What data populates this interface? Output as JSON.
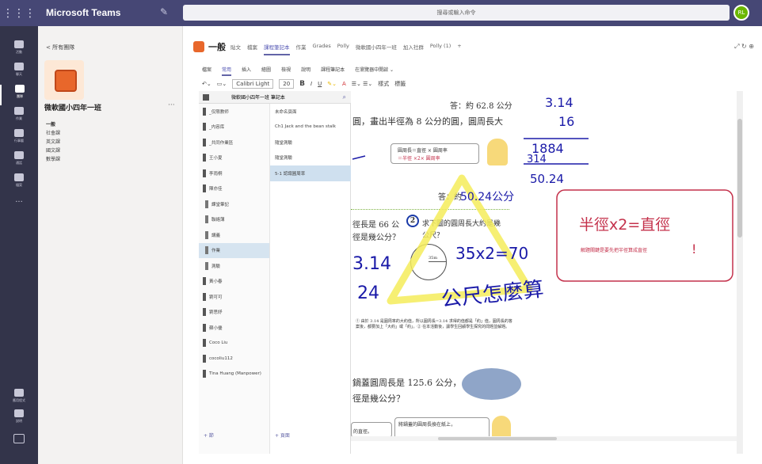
{
  "topbar": {
    "app_title": "Microsoft Teams",
    "search_placeholder": "搜尋或輸入命令",
    "avatar_initials": "RL"
  },
  "rail": {
    "items": [
      "活動",
      "聊天",
      "團隊",
      "作業",
      "行事曆",
      "通話",
      "檔案",
      "..."
    ],
    "bottom": [
      "應用程式",
      "說明"
    ]
  },
  "channels": {
    "back": "< 所有團隊",
    "team_name": "微軟國小四年一班",
    "more": "···",
    "list": [
      "一般",
      "社會課",
      "英文課",
      "國文課",
      "數學課"
    ]
  },
  "header": {
    "channel_title": "一般",
    "tabs": [
      "貼文",
      "檔案",
      "課程筆記本",
      "作業",
      "Grades",
      "Polly",
      "微軟國小四年一班",
      "加入社群",
      "Polly (1)",
      "+"
    ],
    "active_tab": "課程筆記本",
    "right_icons": "⤢  ↻  ⊕"
  },
  "ribbon": {
    "tabs": [
      "檔案",
      "常用",
      "插入",
      "繪圖",
      "檢視",
      "說明",
      "課程筆記本",
      "在瀏覽器中開啟 ⌄"
    ],
    "active_tab": "常用",
    "font": "Calibri Light",
    "size": "20",
    "tools": [
      "B",
      "I",
      "U",
      "A",
      "樣式",
      "標籤"
    ]
  },
  "notebook": {
    "name": "微軟國小四年一班 筆記本",
    "sections": [
      {
        "label": "_仅限教师",
        "sub": false
      },
      {
        "label": "_内容库",
        "sub": false
      },
      {
        "label": "_共同作業區",
        "sub": false
      },
      {
        "label": "王小夏",
        "sub": false
      },
      {
        "label": "李雨桐",
        "sub": false
      },
      {
        "label": "陳亦佳",
        "sub": false
      },
      {
        "label": "課堂筆記",
        "sub": true
      },
      {
        "label": "聯絡薄",
        "sub": true
      },
      {
        "label": "講義",
        "sub": true
      },
      {
        "label": "作業",
        "sub": true,
        "selected": true
      },
      {
        "label": "測驗",
        "sub": true
      },
      {
        "label": "黃小春",
        "sub": false
      },
      {
        "label": "劉可可",
        "sub": false
      },
      {
        "label": "劉思妤",
        "sub": false
      },
      {
        "label": "蘇小優",
        "sub": false
      },
      {
        "label": "Coco Liu",
        "sub": false
      },
      {
        "label": "cocoliu112",
        "sub": false
      },
      {
        "label": "Tina Huang (Manpower)",
        "sub": false
      }
    ],
    "pages": [
      {
        "label": "未命名頁面"
      },
      {
        "label": "Ch1 Jack and the bean stalk"
      },
      {
        "label": "隨堂測驗"
      },
      {
        "label": "隨堂測驗"
      },
      {
        "label": "5-1 認識圓周率",
        "selected": true
      }
    ],
    "add_section": "+ 節",
    "add_page": "+ 頁面"
  },
  "page": {
    "answer1": "答：約 62.8 公分",
    "line1": "圓，畫出半徑為 8 公分的圓，圓周長大",
    "formula_a": "圓周長＝直徑 × 圓周率",
    "formula_b": "＝半徑 ×2× 圓周率",
    "answer2": "答：約",
    "q_left_a": "徑長是 66 公",
    "q_left_b": "徑是幾公分？",
    "q2_num": "2",
    "q2_a": "求下圖的圓周長大約是幾",
    "q2_b": "公尺？",
    "circle_label": "35m",
    "note": "① 由於 3.14 是圓周率的大約值，所以圓周長=3.14 求得的值都是「約」值，圓周長的答案後，都要加上「大約」或「約」。② 在本活動後，讓學生回顧學生探究的問題並解題。",
    "q3_a": "鍋蓋圓周長是 125.6 公分，",
    "q3_b": "徑是幾公分？",
    "bubble_a": "將鍋蓋的圓周長換在紙上，",
    "bubble_b": "的直徑。",
    "ink": {
      "mult_top": "3.14",
      "mult_bottom": "16",
      "prod1": "1884",
      "prod2": "314",
      "result": "50.24",
      "ans2": "50.24公分",
      "box_title": "半徑x2=直徑",
      "box_note": "解題關鍵是要先把半徑算成直徑",
      "exclaim": "!",
      "left_a": "3.14",
      "left_b": "24",
      "eq": "35x2=70",
      "bottom": "公尺怎麼算"
    }
  }
}
